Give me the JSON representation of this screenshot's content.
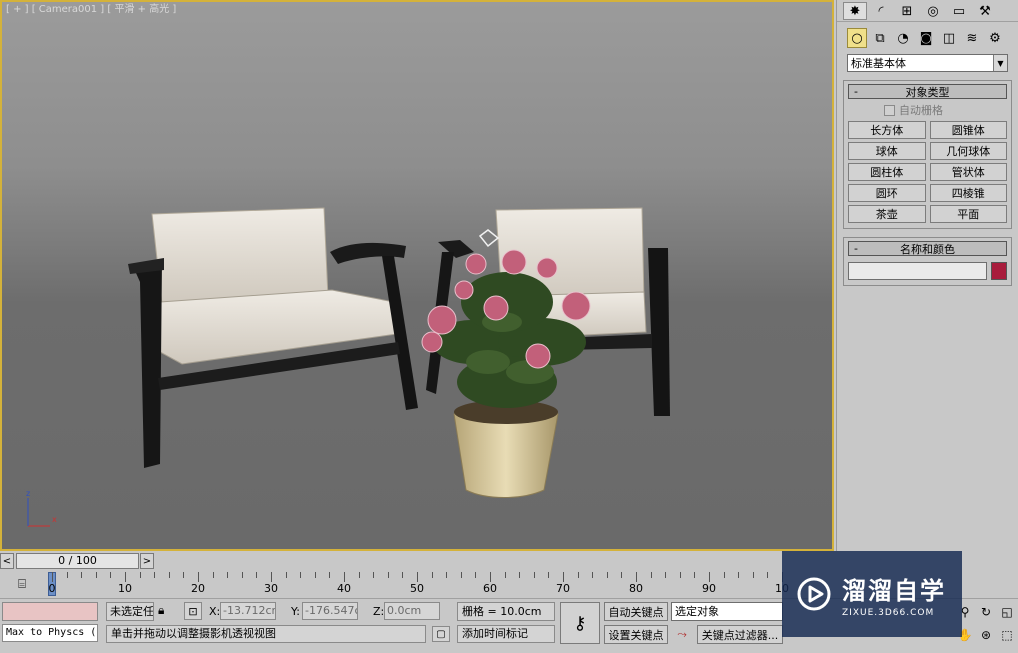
{
  "viewport": {
    "label": "[ + ] [ Camera001 ] [ 平滑 + 高光 ]",
    "axis": {
      "x": "x",
      "z": "z"
    }
  },
  "command_panel": {
    "top_tabs": [
      "create-icon",
      "modify-icon",
      "hierarchy-icon",
      "motion-icon",
      "display-icon",
      "utilities-icon"
    ],
    "sub_tabs": [
      "geometry-icon",
      "shapes-icon",
      "lights-icon",
      "cameras-icon",
      "helpers-icon",
      "spacewarps-icon",
      "systems-icon"
    ],
    "category_dropdown": "标准基本体",
    "object_type": {
      "header_minus": "-",
      "title": "对象类型",
      "autogrid_label": "自动栅格",
      "buttons": [
        "长方体",
        "圆锥体",
        "球体",
        "几何球体",
        "圆柱体",
        "管状体",
        "圆环",
        "四棱锥",
        "茶壶",
        "平面"
      ]
    },
    "name_color": {
      "header_minus": "-",
      "title": "名称和颜色",
      "name_value": "",
      "color": "#a81c3c"
    }
  },
  "timeline": {
    "prev": "<",
    "next": ">",
    "slider_text": "0 / 100",
    "ruler_labels": [
      "0",
      "10",
      "20",
      "30",
      "40",
      "50",
      "60",
      "70",
      "80",
      "90",
      "10"
    ]
  },
  "status": {
    "maxscript": "Max to Physcs (",
    "selection_text": "未选定任",
    "x_label": "X:",
    "x_value": "-13.712cm",
    "y_label": "Y:",
    "y_value": "-176.547cr",
    "z_label": "Z:",
    "z_value": "0.0cm",
    "grid": "栅格 = 10.0cm",
    "prompt": "单击并拖动以调整摄影机透视视图",
    "add_time_tag": "添加时间标记",
    "auto_key": "自动关键点",
    "set_key": "设置关键点",
    "selected_dropdown": "选定对象",
    "key_filters": "关键点过滤器..."
  },
  "watermark": {
    "title": "溜溜自学",
    "url": "ZIXUE.3D66.COM"
  },
  "colors": {
    "viewport_border": "#d4b23a",
    "accent": "#6c8fc6"
  }
}
